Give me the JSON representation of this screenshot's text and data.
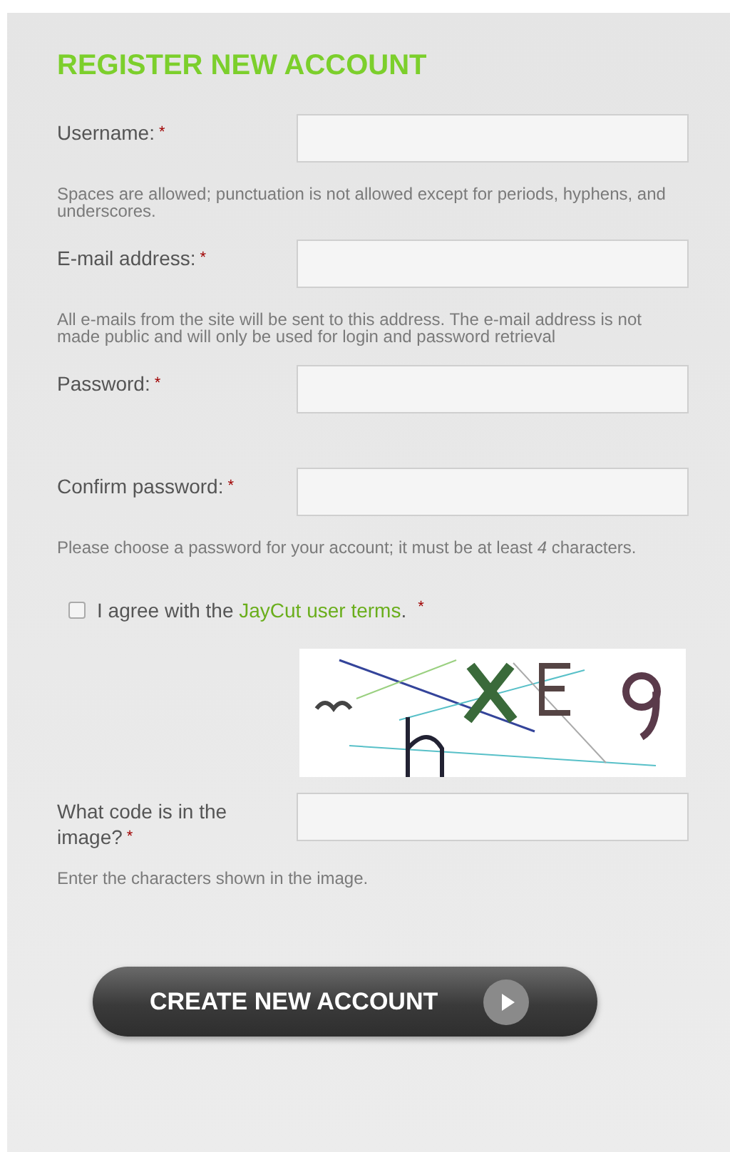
{
  "title": "REGISTER NEW ACCOUNT",
  "fields": [
    {
      "label": "Username:",
      "required_mark": "*",
      "help": "Spaces are allowed; punctuation is not allowed except for periods, hyphens, and underscores."
    },
    {
      "label": "E-mail address:",
      "required_mark": "*",
      "help": "All e-mails from the site will be sent to this address. The e-mail address is not made public and will only be used for login and password retrieval"
    },
    {
      "label": "Password:",
      "required_mark": "*"
    },
    {
      "label": "Confirm password:",
      "required_mark": "*",
      "help": "Please choose a password for your account; it must be at least *4* characters."
    }
  ],
  "terms": {
    "checked": false,
    "text": "I agree with the",
    "link": "JayCut user terms",
    "after": ".",
    "required_mark": "*"
  },
  "captcha": {
    "label": "What code is in the image?",
    "required_mark": "*",
    "help": "Enter the characters shown in the image."
  },
  "submit": {
    "label": "CREATE NEW ACCOUNT"
  }
}
